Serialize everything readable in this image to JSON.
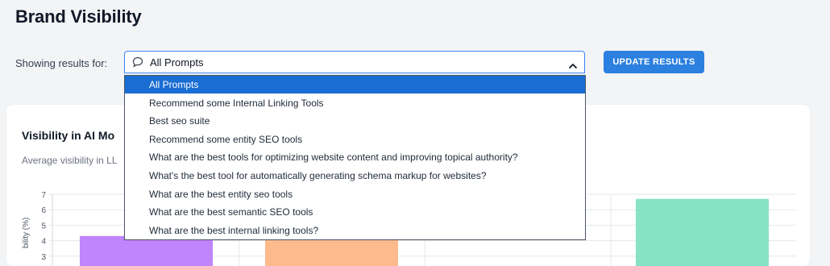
{
  "header": {
    "title": "Brand Visibility"
  },
  "filter": {
    "label": "Showing results for:",
    "selected": "All Prompts",
    "options": [
      "All Prompts",
      "Recommend some Internal Linking Tools",
      "Best seo suite",
      "Recommend some entity SEO tools",
      "What are the best tools for optimizing website content and improving topical authority?",
      "What's the best tool for automatically generating schema markup for websites?",
      "What are the best entity seo tools",
      "What are the best semantic SEO tools",
      "What are the best internal linking tools?"
    ],
    "update_button": "UPDATE RESULTS"
  },
  "card": {
    "title": "Visibility in AI Mo",
    "subtitle": "Average visibility in LL"
  },
  "chart_data": {
    "type": "bar",
    "ylabel": "bility (%)",
    "ylim": [
      0,
      7
    ],
    "yticks": [
      "7",
      "6",
      "5",
      "4",
      "3"
    ],
    "bars": [
      {
        "value": 4.3,
        "color": "#c084fc"
      },
      {
        "value": 4.3,
        "color": "#fdba8c"
      },
      {
        "value": 6.7,
        "color": "#86e3c3"
      }
    ]
  },
  "colors": {
    "accent": "#2b80e0",
    "selected_option": "#1a6dd3"
  }
}
